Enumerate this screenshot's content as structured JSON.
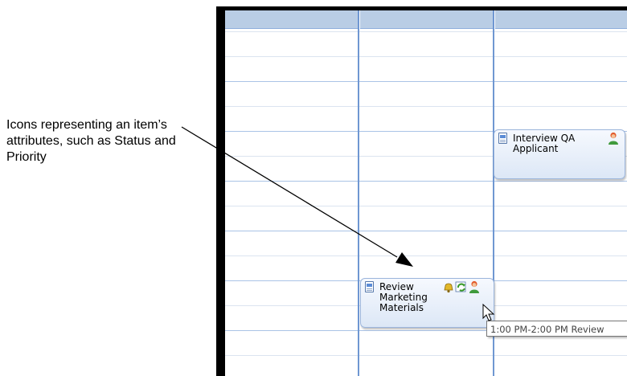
{
  "callout": {
    "text": "Icons representing an item’s attributes, such as Status and Priority"
  },
  "calendar": {
    "columns": 3,
    "appointments": [
      {
        "title": "Interview QA Applicant",
        "icons": [
          "document-icon",
          "person-icon"
        ]
      },
      {
        "title": "Review Marketing Materials",
        "icons": [
          "document-icon",
          "bell-icon",
          "recurrence-icon",
          "person-icon"
        ]
      }
    ]
  },
  "tooltip": {
    "text": "1:00 PM-2:00 PM Review"
  },
  "colors": {
    "header": "#b9cde5",
    "column_separator": "#6f97d2",
    "appointment_border": "#9bb5dc"
  }
}
